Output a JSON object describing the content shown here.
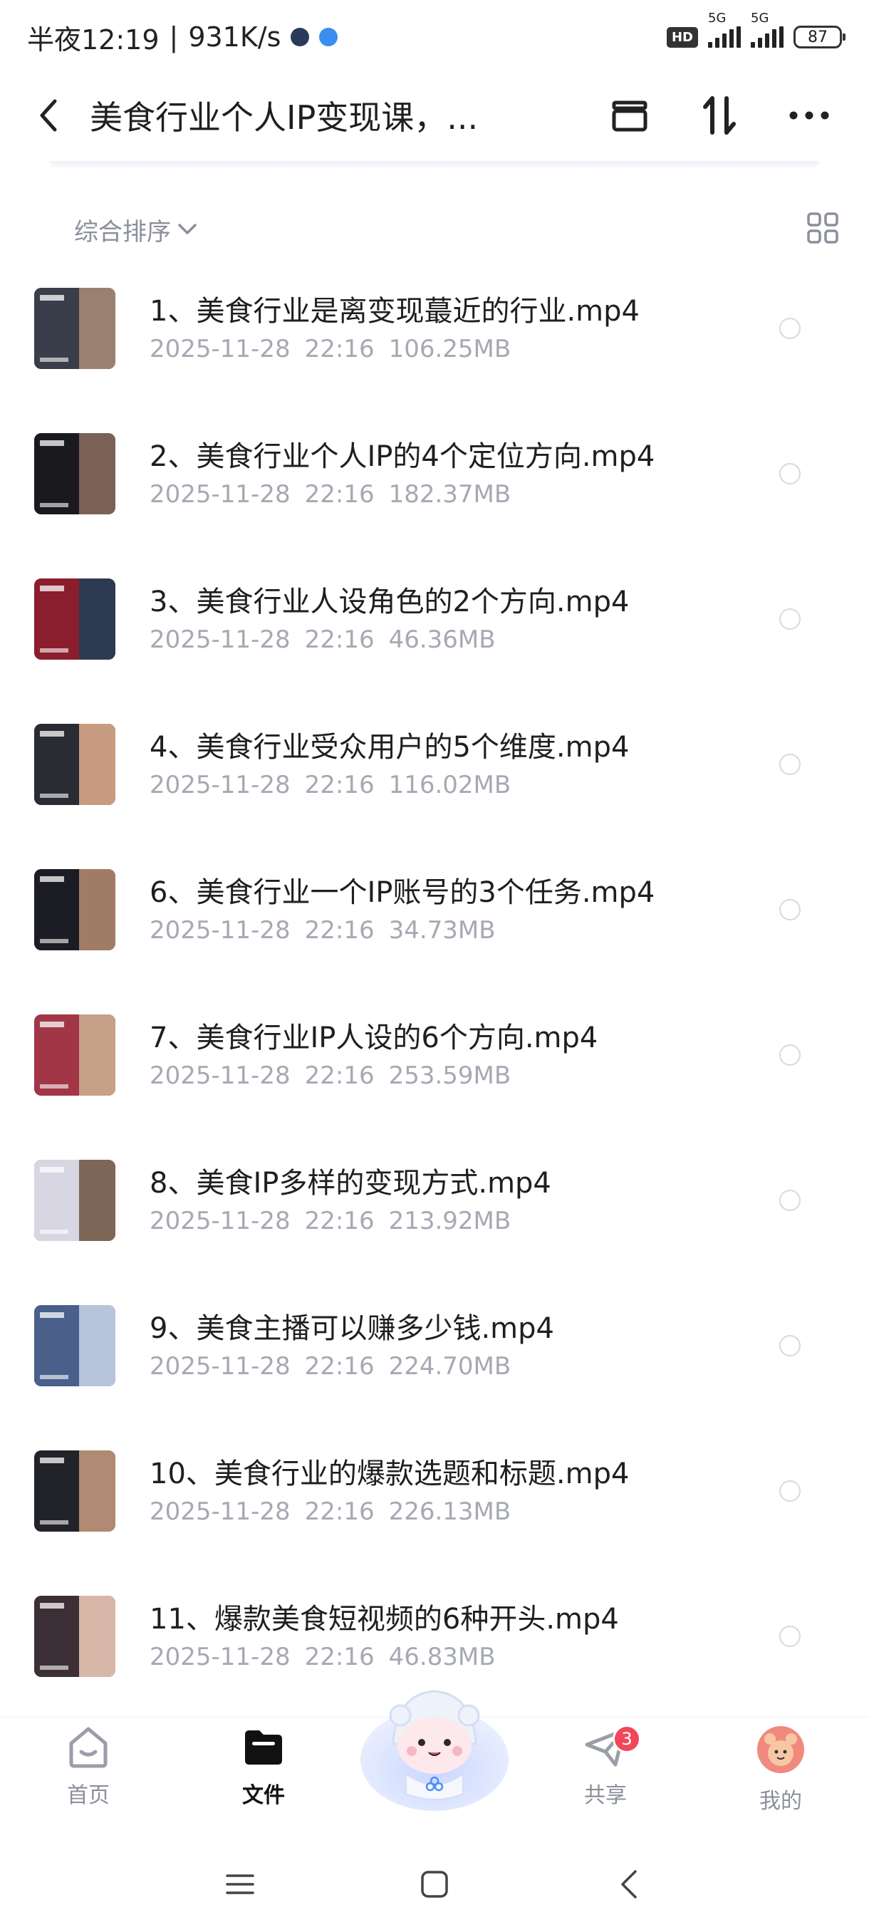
{
  "status_bar": {
    "time": "半夜12:19",
    "speed": "931K/s",
    "hd": "HD",
    "network_1": "5G",
    "network_2": "5G",
    "battery": "87"
  },
  "title_bar": {
    "title": "美食行业个人IP变现课，..."
  },
  "sort": {
    "label": "综合排序"
  },
  "files": [
    {
      "name": "1、美食行业是离变现蕞近的行业.mp4",
      "date": "2025-11-28",
      "time": "22:16",
      "size": "106.25MB",
      "colors": [
        "#3a3d4a",
        "#9a8070"
      ]
    },
    {
      "name": "2、美食行业个人IP的4个定位方向.mp4",
      "date": "2025-11-28",
      "time": "22:16",
      "size": "182.37MB",
      "colors": [
        "#1a1a1e",
        "#7a6055"
      ]
    },
    {
      "name": "3、美食行业人设角色的2个方向.mp4",
      "date": "2025-11-28",
      "time": "22:16",
      "size": "46.36MB",
      "colors": [
        "#8b1e2d",
        "#2e3a52"
      ]
    },
    {
      "name": "4、美食行业受众用户的5个维度.mp4",
      "date": "2025-11-28",
      "time": "22:16",
      "size": "116.02MB",
      "colors": [
        "#2a2b33",
        "#c89c80"
      ]
    },
    {
      "name": "6、美食行业一个IP账号的3个任务.mp4",
      "date": "2025-11-28",
      "time": "22:16",
      "size": "34.73MB",
      "colors": [
        "#1c1d24",
        "#a07c66"
      ]
    },
    {
      "name": "7、美食行业IP人设的6个方向.mp4",
      "date": "2025-11-28",
      "time": "22:16",
      "size": "253.59MB",
      "colors": [
        "#a03646",
        "#c7a088"
      ]
    },
    {
      "name": "8、美食IP多样的变现方式.mp4",
      "date": "2025-11-28",
      "time": "22:16",
      "size": "213.92MB",
      "colors": [
        "#d8d6e2",
        "#7d6658"
      ]
    },
    {
      "name": "9、美食主播可以赚多少钱.mp4",
      "date": "2025-11-28",
      "time": "22:16",
      "size": "224.70MB",
      "colors": [
        "#4a5f8a",
        "#b8c3dc"
      ]
    },
    {
      "name": "10、美食行业的爆款选题和标题.mp4",
      "date": "2025-11-28",
      "time": "22:16",
      "size": "226.13MB",
      "colors": [
        "#222329",
        "#b08a72"
      ]
    },
    {
      "name": "11、爆款美食短视频的6种开头.mp4",
      "date": "2025-11-28",
      "time": "22:16",
      "size": "46.83MB",
      "colors": [
        "#3c2f36",
        "#d7b8a8"
      ]
    }
  ],
  "bottom_nav": {
    "home": "首页",
    "files": "文件",
    "share": "共享",
    "share_badge": "3",
    "mine": "我的"
  },
  "colors": {
    "text_primary": "#1f1f1f",
    "text_secondary": "#a6a9b3",
    "badge": "#f2475a"
  }
}
